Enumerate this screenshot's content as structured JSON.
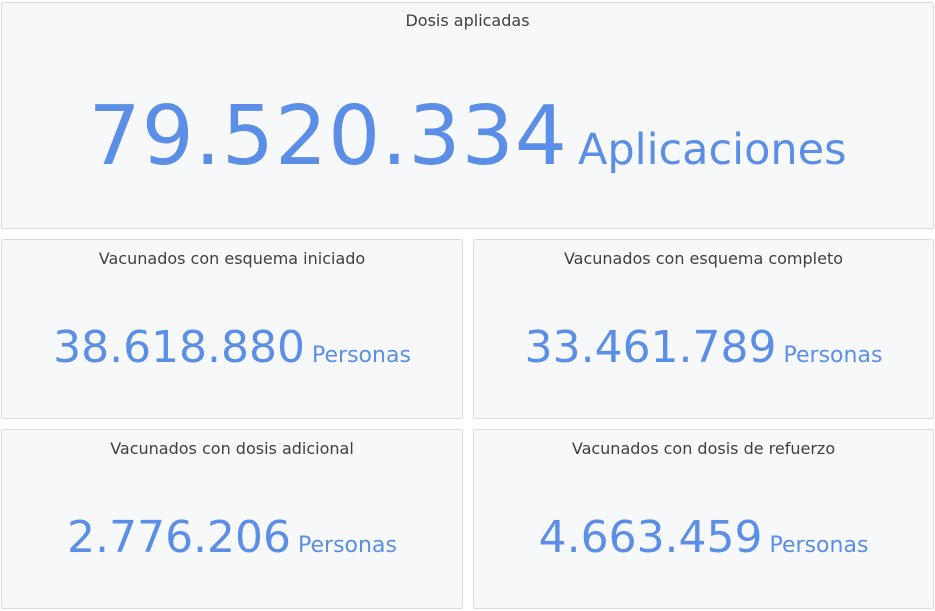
{
  "panels": {
    "dosis": {
      "title": "Dosis aplicadas",
      "value": "79.520.334",
      "unit": "Aplicaciones"
    },
    "iniciado": {
      "title": "Vacunados con esquema iniciado",
      "value": "38.618.880",
      "unit": "Personas"
    },
    "completo": {
      "title": "Vacunados con esquema completo",
      "value": "33.461.789",
      "unit": "Personas"
    },
    "adicional": {
      "title": "Vacunados con dosis adicional",
      "value": "2.776.206",
      "unit": "Personas"
    },
    "refuerzo": {
      "title": "Vacunados con dosis de refuerzo",
      "value": "4.663.459",
      "unit": "Personas"
    }
  },
  "colors": {
    "accent": "#5b8ee6",
    "panel_bg": "#f7f8fa",
    "panel_border": "#dcdee3",
    "title_text": "#404040"
  }
}
